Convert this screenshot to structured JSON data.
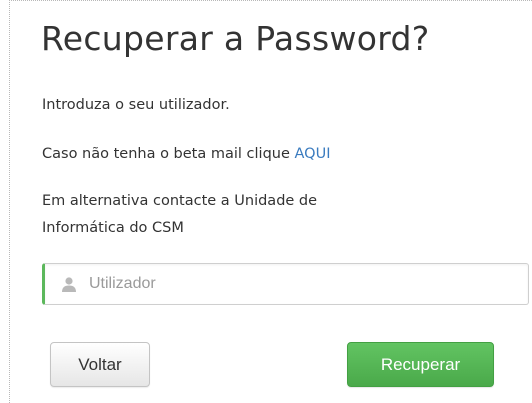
{
  "form": {
    "title": "Recuperar a Password?",
    "intro": "Introduza o seu utilizador.",
    "beta_text": "Caso não tenha o beta mail clique ",
    "beta_link": "AQUI",
    "alt_line1": "Em alternativa contacte a Unidade de",
    "alt_line2": "Informática do CSM",
    "username": {
      "placeholder": "Utilizador",
      "value": "",
      "icon": "user-icon"
    },
    "back_label": "Voltar",
    "recover_label": "Recuperar"
  },
  "colors": {
    "accent_green": "#5cb85c",
    "link_blue": "#3a7bbf",
    "text": "#333333"
  }
}
